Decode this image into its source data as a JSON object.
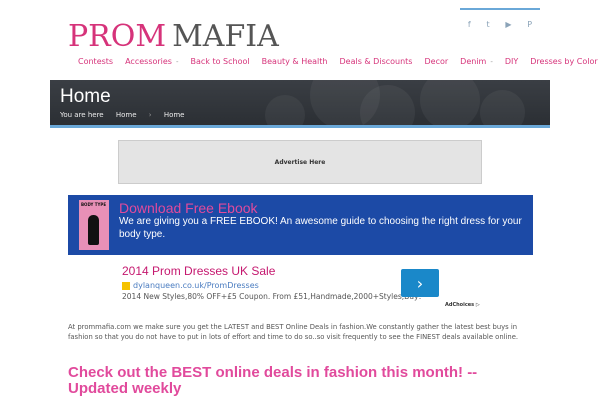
{
  "header": {
    "logo_prom": "PROM",
    "logo_mafia": "MAFIA",
    "social_icons": [
      "facebook-icon",
      "twitter-icon",
      "youtube-icon",
      "pinterest-icon"
    ]
  },
  "nav": {
    "items": [
      {
        "label": "Contests",
        "dropdown": false
      },
      {
        "label": "Accessories",
        "dropdown": true
      },
      {
        "label": "Back to School",
        "dropdown": false
      },
      {
        "label": "Beauty & Health",
        "dropdown": false
      },
      {
        "label": "Deals & Discounts",
        "dropdown": false
      },
      {
        "label": "Decor",
        "dropdown": false
      },
      {
        "label": "Denim",
        "dropdown": true
      },
      {
        "label": "DIY",
        "dropdown": false
      },
      {
        "label": "Dresses by Color",
        "dropdown": true
      }
    ]
  },
  "hero": {
    "title": "Home",
    "crumb_prefix": "You are here",
    "crumb_home": "Home",
    "crumb_sep": "›",
    "crumb_current": "Home"
  },
  "adbox": {
    "label": "Advertise Here"
  },
  "ebook": {
    "cover_title": "BODY TYPE",
    "title": "Download Free Ebook",
    "text": "We are giving you a FREE EBOOK! An awesome guide to choosing the right dress for your body type."
  },
  "google_ad": {
    "title": "2014 Prom Dresses UK Sale",
    "url": "dylanqueen.co.uk/PromDresses",
    "description": "2014 New Styles,80% OFF+£5 Coupon. From £51,Handmade,2000+Styles,Buy!",
    "button": "›",
    "adchoices": "AdChoices ▷"
  },
  "content": {
    "intro": "At prommafia.com we make sure you get the LATEST and BEST Online Deals in fashion.We constantly gather the latest best buys in fashion so that you do not have to put in lots of effort and time to do so..so visit frequently to see the FINEST deals available online.",
    "headline": "Check out the BEST online deals in fashion this month! -- Updated weekly"
  },
  "colors": {
    "brand_pink": "#d6337a",
    "ebook_blue": "#1c4aa6",
    "accent_blue": "#6aa8d8"
  }
}
